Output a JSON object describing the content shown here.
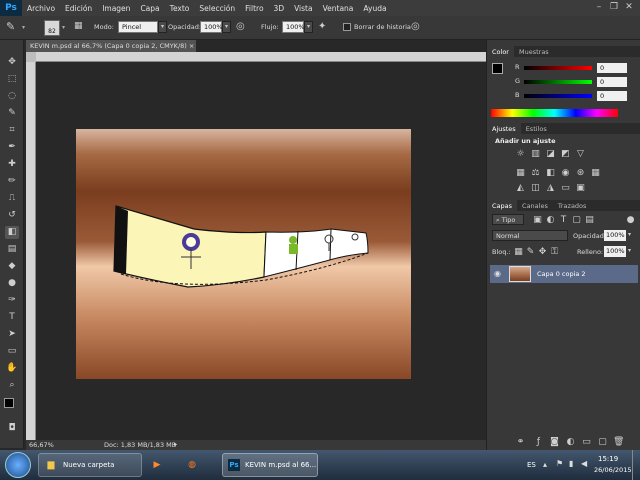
{
  "app": {
    "logo": "Ps"
  },
  "menu": [
    "Archivo",
    "Edición",
    "Imagen",
    "Capa",
    "Texto",
    "Selección",
    "Filtro",
    "3D",
    "Vista",
    "Ventana",
    "Ayuda"
  ],
  "options": {
    "brush_size": "82",
    "modo_label": "Modo:",
    "modo_value": "Pincel",
    "opacidad_label": "Opacidad:",
    "opacidad_value": "100%",
    "flujo_label": "Flujo:",
    "flujo_value": "100%",
    "borrar_label": "Borrar de historia"
  },
  "document": {
    "tab_title": "KEVIN m.psd al 66,7% (Capa 0 copia 2, CMYK/8)",
    "zoom": "66,67%",
    "doc_info": "Doc: 1,83 MB/1,83 MB"
  },
  "color_panel": {
    "tabs": [
      "Color",
      "Muestras"
    ],
    "channels": [
      {
        "name": "R",
        "value": "0"
      },
      {
        "name": "G",
        "value": "0"
      },
      {
        "name": "B",
        "value": "0"
      }
    ]
  },
  "adjust_panel": {
    "tabs": [
      "Ajustes",
      "Estilos"
    ],
    "heading": "Añadir un ajuste"
  },
  "layers_panel": {
    "tabs": [
      "Capas",
      "Canales",
      "Trazados"
    ],
    "filter_label": "Tipo",
    "blend_mode": "Normal",
    "opacity_label": "Opacidad:",
    "opacity_value": "100%",
    "lock_label": "Bloq.:",
    "fill_label": "Relleno:",
    "fill_value": "100%",
    "layers": [
      {
        "name": "Capa 0 copia 2"
      }
    ]
  },
  "taskbar": {
    "folder_label": "Nueva carpeta",
    "ps_label": "KEVIN m.psd al 66...",
    "lang": "ES",
    "time": "15:19",
    "date": "26/06/2015"
  },
  "icons": [
    "brush-icon",
    "move-icon",
    "marquee-icon",
    "lasso-icon",
    "eraser-icon",
    "eye-icon",
    "start-icon",
    "firefox-icon",
    "media-icon",
    "folder-icon"
  ]
}
